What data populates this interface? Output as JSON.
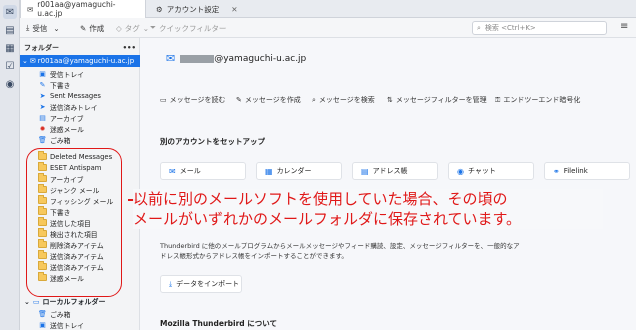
{
  "tabs": [
    {
      "label": "r001aa@yamaguchi-u.ac.jp",
      "icon": "mail-icon"
    },
    {
      "label": "アカウント設定",
      "icon": "gear-icon"
    }
  ],
  "toolbar": {
    "get_messages": "受信",
    "write": "作成",
    "tag": "タグ",
    "quick_filter": "クイックフィルター",
    "search_placeholder": "検索 <Ctrl+K>"
  },
  "folder_pane": {
    "header": "フォルダー",
    "account": "r001aa@yamaguchi-u.ac.jp",
    "folders": [
      {
        "label": "受信トレイ",
        "icon": "inbox-icon"
      },
      {
        "label": "下書き",
        "icon": "draft-icon"
      },
      {
        "label": "Sent Messages",
        "icon": "sent-icon"
      },
      {
        "label": "送信済みトレイ",
        "icon": "sent-icon"
      },
      {
        "label": "アーカイブ",
        "icon": "archive-icon"
      },
      {
        "label": "迷惑メール",
        "icon": "junk-icon"
      },
      {
        "label": "ごみ箱",
        "icon": "trash-icon"
      },
      {
        "label": "Deleted Messages",
        "icon": "folder-icon"
      },
      {
        "label": "ESET Antispam",
        "icon": "folder-icon"
      },
      {
        "label": "アーカイブ",
        "icon": "folder-icon"
      },
      {
        "label": "ジャンク メール",
        "icon": "folder-icon"
      },
      {
        "label": "フィッシング メール",
        "icon": "folder-icon"
      },
      {
        "label": "下書き",
        "icon": "folder-icon"
      },
      {
        "label": "送信した項目",
        "icon": "folder-icon"
      },
      {
        "label": "検出された項目",
        "icon": "folder-icon"
      },
      {
        "label": "削除済みアイテム",
        "icon": "folder-icon"
      },
      {
        "label": "送信済みアイテム",
        "icon": "folder-icon"
      },
      {
        "label": "送信済みアイテム",
        "icon": "folder-icon"
      },
      {
        "label": "迷惑メール",
        "icon": "folder-icon"
      }
    ],
    "local_folders": "ローカルフォルダー",
    "local_items": [
      {
        "label": "ごみ箱",
        "icon": "trash-icon"
      },
      {
        "label": "送信トレイ",
        "icon": "outbox-icon"
      }
    ]
  },
  "main": {
    "account_suffix": "@yamaguchi-u.ac.jp",
    "actions": [
      "メッセージを読む",
      "メッセージを作成",
      "メッセージを検索",
      "メッセージフィルターを管理",
      "エンドツーエンド暗号化"
    ],
    "setup_title": "別のアカウントをセットアップ",
    "setup_cards": [
      "メール",
      "カレンダー",
      "アドレス帳",
      "チャット",
      "Filelink"
    ],
    "import_desc": "Thunderbird に他のメールプログラムからメールメッセージやフィード購読、設定、メッセージフィルターを、一般的なアドレス帳形式からアドレス帳をインポートすることができます。",
    "import_button": "データをインポート",
    "about_title": "Mozilla Thunderbird について"
  },
  "annotation": {
    "line1": "以前に別のメールソフトを使用していた場合、その頃の",
    "line2": "メールがいずれかのメールフォルダに保存されています。",
    "color": "#e01818"
  }
}
